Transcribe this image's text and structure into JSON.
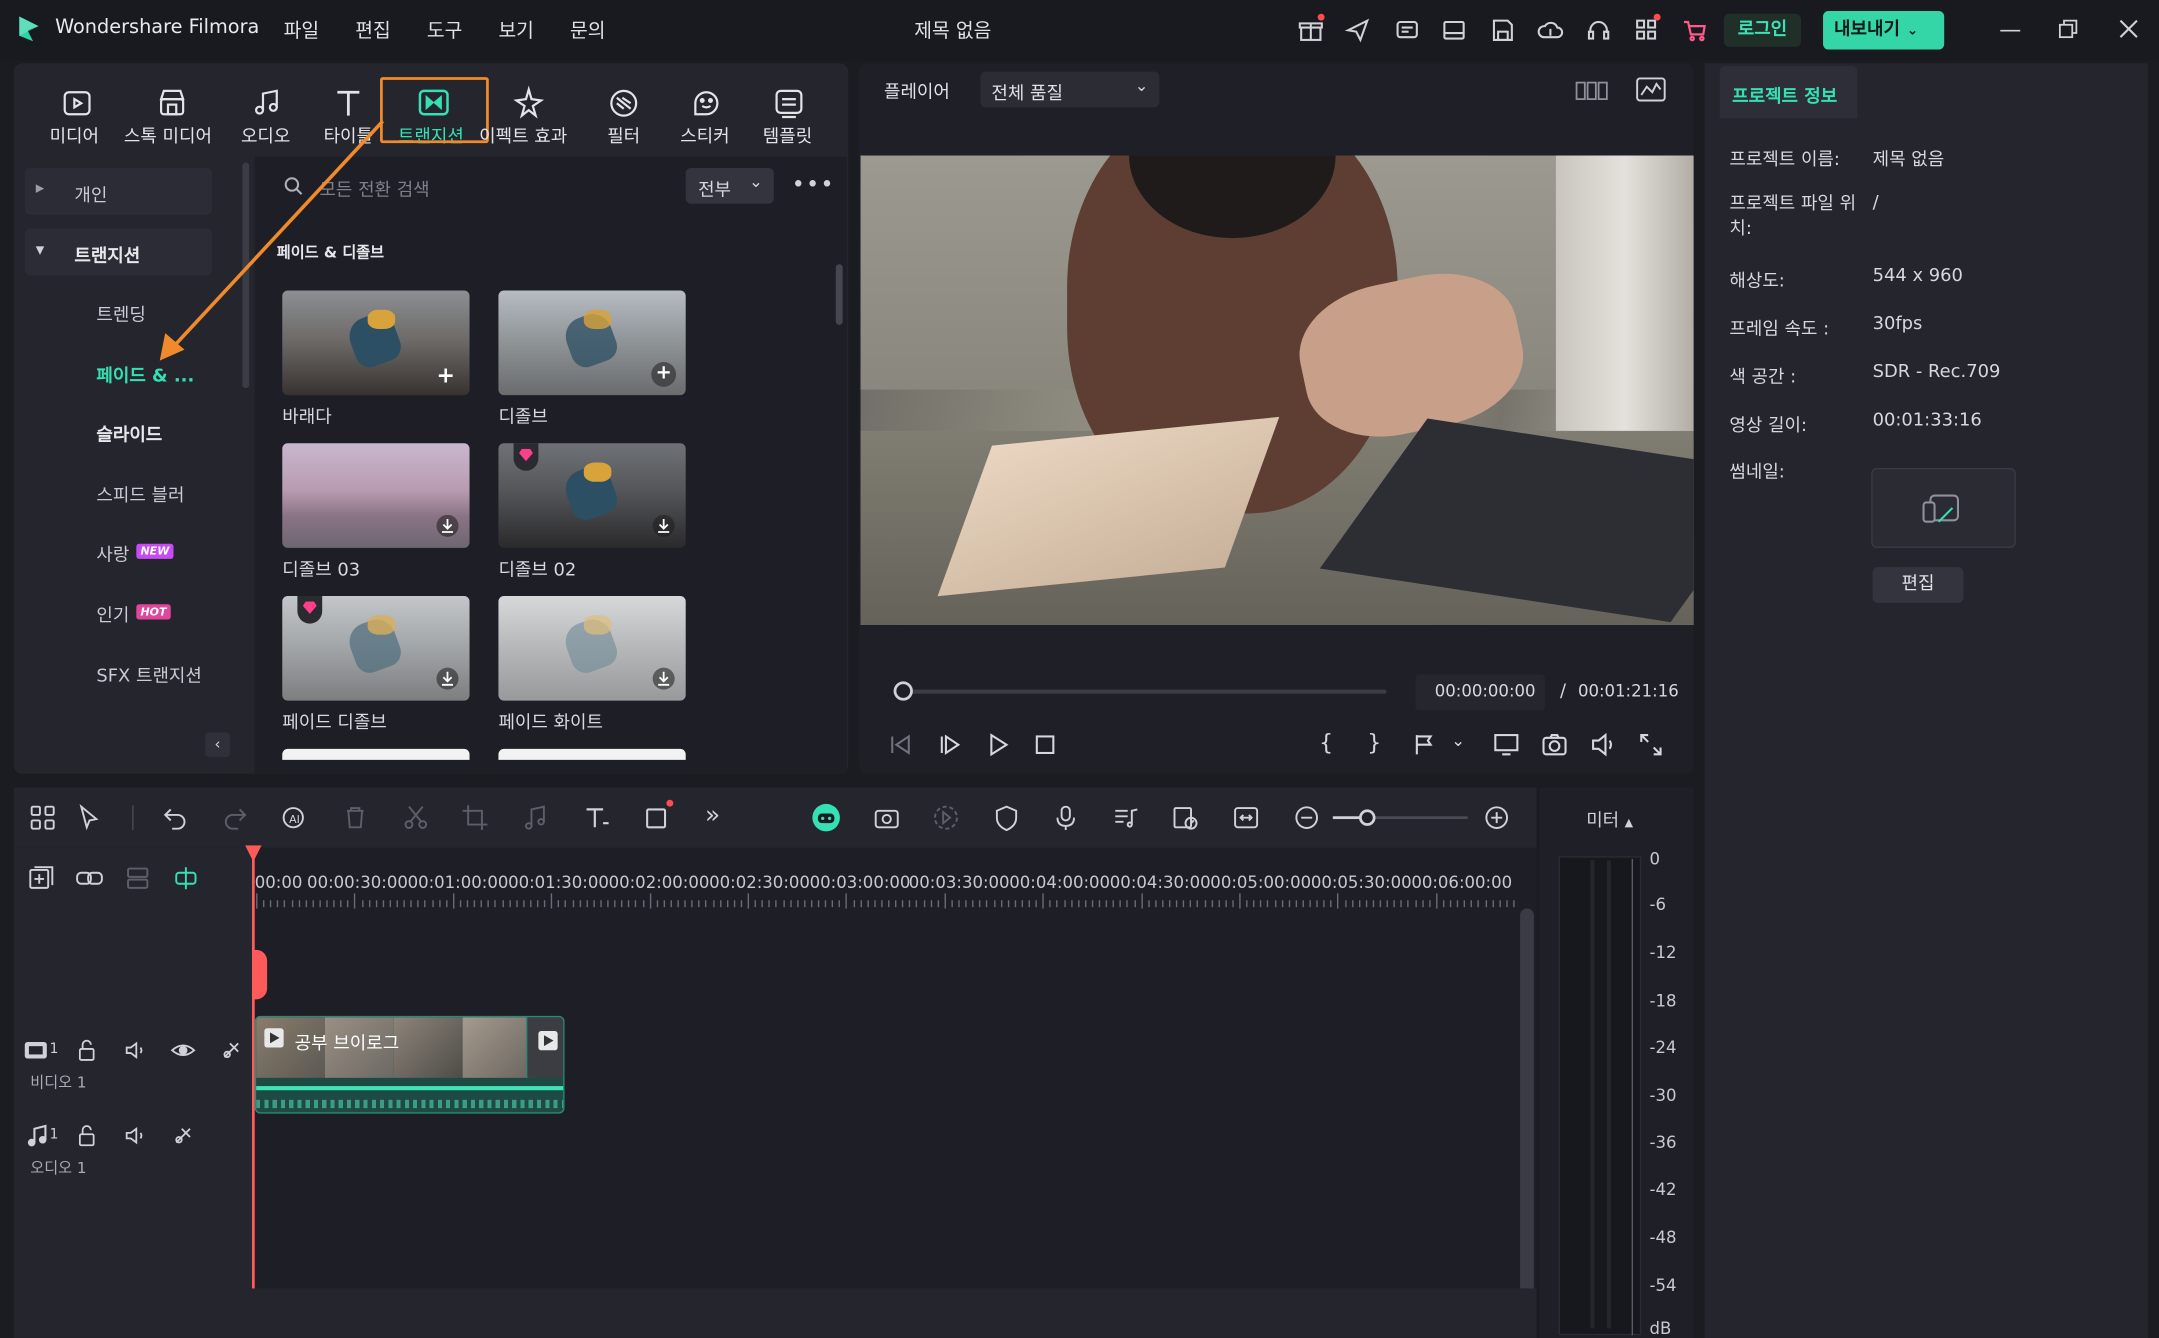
{
  "app": {
    "title": "Wondershare Filmora",
    "doc_title": "제목 없음"
  },
  "menu": [
    "파일",
    "편집",
    "도구",
    "보기",
    "문의"
  ],
  "header": {
    "login": "로그인",
    "export": "내보내기"
  },
  "tabs": [
    {
      "label": "미디어",
      "icon": "media-icon"
    },
    {
      "label": "스톡 미디어",
      "icon": "stock-media-icon"
    },
    {
      "label": "오디오",
      "icon": "audio-icon"
    },
    {
      "label": "타이틀",
      "icon": "title-icon"
    },
    {
      "label": "트랜지션",
      "icon": "transition-icon",
      "active": true
    },
    {
      "label": "이펙트 효과",
      "icon": "effects-icon"
    },
    {
      "label": "필터",
      "icon": "filter-icon"
    },
    {
      "label": "스티커",
      "icon": "sticker-icon"
    },
    {
      "label": "템플릿",
      "icon": "template-icon"
    }
  ],
  "sidebar": {
    "personal": "개인",
    "transitions": "트랜지션",
    "items": [
      {
        "label": "트렌딩"
      },
      {
        "label": "페이드 & ...",
        "active": true
      },
      {
        "label": "슬라이드",
        "bold": true
      },
      {
        "label": "스피드 블러"
      },
      {
        "label": "사랑",
        "badge": "NEW"
      },
      {
        "label": "인기",
        "badge": "HOT"
      },
      {
        "label": "SFX 트랜지션"
      }
    ]
  },
  "search": {
    "placeholder": "모든 전환 검색",
    "filter": "전부"
  },
  "section_title": "페이드 & 디졸브",
  "thumbs": [
    {
      "label": "바래다",
      "action": "add"
    },
    {
      "label": "디졸브",
      "action": "add"
    },
    {
      "label": "디졸브 03",
      "action": "download"
    },
    {
      "label": "디졸브 02",
      "action": "download",
      "premium": true
    },
    {
      "label": "페이드 디졸브",
      "action": "download",
      "premium": true
    },
    {
      "label": "페이드 화이트",
      "action": "download"
    }
  ],
  "player": {
    "label": "플레이어",
    "quality": "전체 품질",
    "current": "00:00:00:00",
    "separator": "/",
    "total": "00:01:21:16",
    "progress": 0.0
  },
  "project": {
    "tab": "프로젝트 정보",
    "fields": [
      {
        "k": "프로젝트 이름:",
        "v": "제목 없음"
      },
      {
        "k": "프로젝트 파일 위치:",
        "v": "/"
      },
      {
        "k": "해상도:",
        "v": "544 x 960"
      },
      {
        "k": "프레임 속도 :",
        "v": "30fps"
      },
      {
        "k": "색 공간 :",
        "v": "SDR - Rec.709"
      },
      {
        "k": "영상 길이:",
        "v": "00:01:33:16"
      },
      {
        "k": "썸네일:",
        "v": ""
      }
    ],
    "edit": "편집"
  },
  "timeline": {
    "ruler": [
      "00:00",
      "00:00:30:00",
      "00:01:00:00",
      "00:01:30:00",
      "00:02:00:00",
      "00:02:30:00",
      "00:03:00:00",
      "00:03:30:00",
      "00:04:00:00",
      "00:04:30:00",
      "00:05:00:00",
      "00:05:30:00",
      "00:06:00:00"
    ],
    "clip": "공부 브이로그",
    "video_track": "비디오 1",
    "audio_track": "오디오 1",
    "track_num": "1",
    "zoom": 0.25
  },
  "meter": {
    "label": "미터",
    "ticks": [
      "0",
      "-6",
      "-12",
      "-18",
      "-24",
      "-30",
      "-36",
      "-42",
      "-48",
      "-54",
      "dB"
    ]
  },
  "colors": {
    "accent": "#35e0b4",
    "highlight": "#f08a2a",
    "playhead": "#ff5a5a"
  }
}
